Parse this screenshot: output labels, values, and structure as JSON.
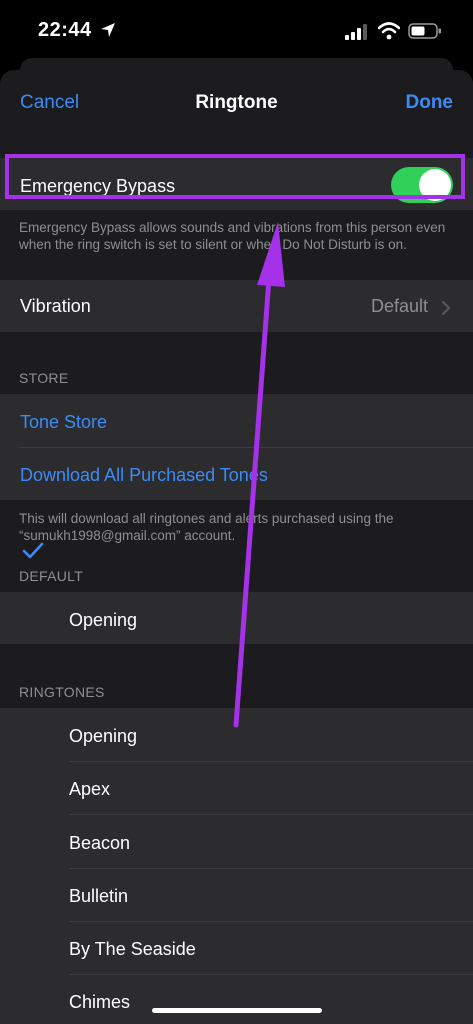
{
  "status_bar": {
    "time": "22:44"
  },
  "nav": {
    "cancel": "Cancel",
    "title": "Ringtone",
    "done": "Done"
  },
  "emergency_bypass": {
    "label": "Emergency Bypass",
    "enabled": true,
    "description": "Emergency Bypass allows sounds and vibrations from this person even when the ring switch is set to silent or when Do Not Disturb is on."
  },
  "vibration": {
    "label": "Vibration",
    "value": "Default"
  },
  "store": {
    "header": "STORE",
    "tone_store": "Tone Store",
    "download_all": "Download All Purchased Tones",
    "footnote": "This will download all ringtones and alerts purchased using the “sumukh1998@gmail.com” account."
  },
  "default_section": {
    "header": "DEFAULT",
    "selected": "Opening"
  },
  "ringtones": {
    "header": "RINGTONES",
    "items": [
      "Opening",
      "Apex",
      "Beacon",
      "Bulletin",
      "By The Seaside",
      "Chimes"
    ]
  },
  "colors": {
    "accent": "#3b8cf6",
    "toggle_on": "#30d158",
    "highlight": "#a531e8"
  },
  "icons": [
    "location-arrow-icon",
    "cellular-signal-icon",
    "wifi-icon",
    "battery-icon",
    "chevron-right-icon",
    "checkmark-icon",
    "annotation-arrow"
  ]
}
